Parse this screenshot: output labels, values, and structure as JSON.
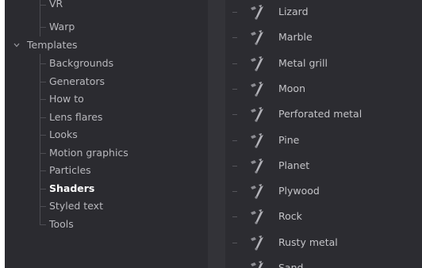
{
  "left_tree": {
    "items": [
      {
        "label": "VR",
        "indent": 1,
        "selected": false
      },
      {
        "label": "Warp",
        "indent": 1,
        "selected": false
      },
      {
        "label": "Templates",
        "indent": 0,
        "selected": false,
        "expanded": true
      },
      {
        "label": "Backgrounds",
        "indent": 1,
        "selected": false
      },
      {
        "label": "Generators",
        "indent": 1,
        "selected": false
      },
      {
        "label": "How to",
        "indent": 1,
        "selected": false
      },
      {
        "label": "Lens flares",
        "indent": 1,
        "selected": false
      },
      {
        "label": "Looks",
        "indent": 1,
        "selected": false
      },
      {
        "label": "Motion graphics",
        "indent": 1,
        "selected": false
      },
      {
        "label": "Particles",
        "indent": 1,
        "selected": false
      },
      {
        "label": "Shaders",
        "indent": 1,
        "selected": true
      },
      {
        "label": "Styled text",
        "indent": 1,
        "selected": false
      },
      {
        "label": "Tools",
        "indent": 1,
        "selected": false
      }
    ],
    "icons": {
      "expand": "chevron-down-icon"
    }
  },
  "shader_list": {
    "icon": "paint-tool-icon",
    "items": [
      "Lizard",
      "Marble",
      "Metal grill",
      "Moon",
      "Perforated metal",
      "Pine",
      "Planet",
      "Plywood",
      "Rock",
      "Rusty metal",
      "Sand"
    ]
  },
  "colors": {
    "background": "#2e2e33",
    "text": "#b8b8bd",
    "selected_text": "#ffffff"
  }
}
